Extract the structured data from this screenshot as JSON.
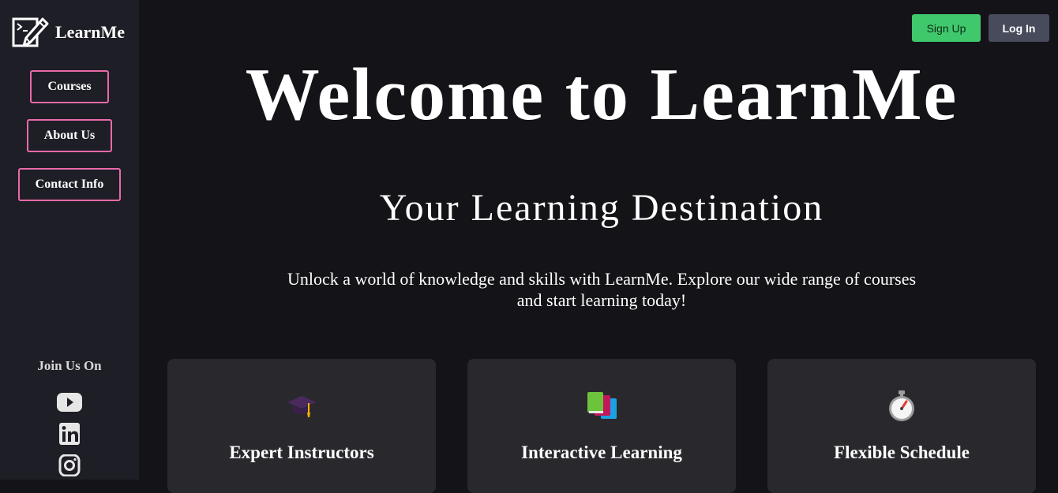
{
  "brand": {
    "name": "LearnMe",
    "logo_icon": "pencil-code-icon"
  },
  "sidebar": {
    "nav": [
      {
        "label": "Courses"
      },
      {
        "label": "About Us"
      },
      {
        "label": "Contact Info"
      }
    ],
    "join_label": "Join Us On",
    "social": [
      "youtube-icon",
      "linkedin-icon",
      "instagram-icon"
    ]
  },
  "header": {
    "signup_label": "Sign Up",
    "login_label": "Log In"
  },
  "hero": {
    "title": "Welcome to LearnMe",
    "subtitle": "Your Learning Destination",
    "description": "Unlock a world of knowledge and skills with LearnMe. Explore our wide range of courses and start learning today!"
  },
  "features": [
    {
      "title": "Expert Instructors",
      "icon": "graduation-cap-icon"
    },
    {
      "title": "Interactive Learning",
      "icon": "books-icon"
    },
    {
      "title": "Flexible Schedule",
      "icon": "stopwatch-icon"
    }
  ],
  "colors": {
    "background": "#141418",
    "sidebar": "#1e1e26",
    "nav_border": "#e86aa8",
    "signup": "#3fc86c",
    "login": "#474b5c",
    "card": "#29292d"
  }
}
